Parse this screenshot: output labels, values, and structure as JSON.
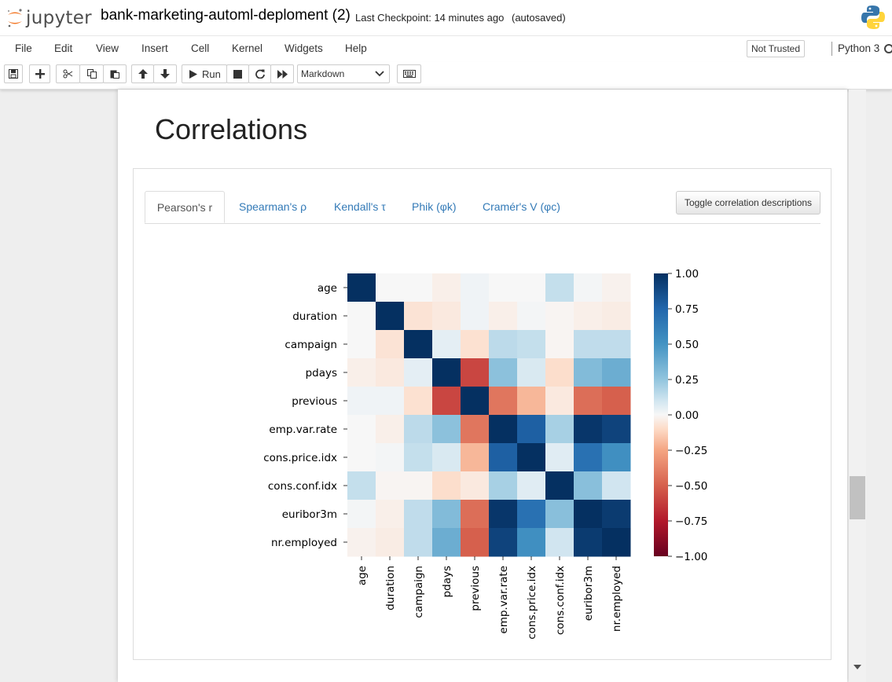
{
  "header": {
    "logo_text": "jupyter",
    "notebook_title": "bank-marketing-automl-deploment (2)",
    "checkpoint": "Last Checkpoint: 14 minutes ago",
    "autosave": "(autosaved)"
  },
  "menu": {
    "items": [
      "File",
      "Edit",
      "View",
      "Insert",
      "Cell",
      "Kernel",
      "Widgets",
      "Help"
    ],
    "trust_label": "Not Trusted",
    "kernel": "Python 3"
  },
  "toolbar": {
    "run_label": "Run",
    "cell_type": "Markdown"
  },
  "cell": {
    "heading": "Correlations"
  },
  "tabs": {
    "items": [
      "Pearson's r",
      "Spearman's ρ",
      "Kendall's τ",
      "Phik (φk)",
      "Cramér's V (φc)"
    ],
    "active_index": 0,
    "toggle_label": "Toggle correlation descriptions"
  },
  "colors": {
    "accent_link": "#337ab7",
    "cmap_low": "#67001f",
    "cmap_mid": "#f7f7f7",
    "cmap_high": "#053061"
  },
  "chart_data": {
    "type": "heatmap",
    "title": "",
    "rows": [
      "age",
      "duration",
      "campaign",
      "pdays",
      "previous",
      "emp.var.rate",
      "cons.price.idx",
      "cons.conf.idx",
      "euribor3m",
      "nr.employed"
    ],
    "columns": [
      "age",
      "duration",
      "campaign",
      "pdays",
      "previous",
      "emp.var.rate",
      "cons.price.idx",
      "cons.conf.idx",
      "euribor3m",
      "nr.employed"
    ],
    "values": [
      [
        1.0,
        0.0,
        0.0,
        -0.03,
        0.02,
        0.0,
        0.0,
        0.13,
        0.01,
        -0.02
      ],
      [
        0.0,
        1.0,
        -0.07,
        -0.05,
        0.02,
        -0.03,
        0.01,
        -0.01,
        -0.03,
        -0.04
      ],
      [
        0.0,
        -0.07,
        1.0,
        0.05,
        -0.08,
        0.15,
        0.13,
        -0.01,
        0.14,
        0.14
      ],
      [
        -0.03,
        -0.05,
        0.05,
        1.0,
        -0.59,
        0.27,
        0.08,
        -0.09,
        0.3,
        0.37
      ],
      [
        0.02,
        0.02,
        -0.08,
        -0.59,
        1.0,
        -0.42,
        -0.2,
        -0.05,
        -0.45,
        -0.5
      ],
      [
        0.0,
        -0.03,
        0.15,
        0.27,
        -0.42,
        1.0,
        0.78,
        0.2,
        0.97,
        0.91
      ],
      [
        0.0,
        0.01,
        0.13,
        0.08,
        -0.2,
        0.78,
        1.0,
        0.06,
        0.69,
        0.52
      ],
      [
        0.13,
        -0.01,
        -0.01,
        -0.09,
        -0.05,
        0.2,
        0.06,
        1.0,
        0.28,
        0.1
      ],
      [
        0.01,
        -0.03,
        0.14,
        0.3,
        -0.45,
        0.97,
        0.69,
        0.28,
        1.0,
        0.95
      ],
      [
        -0.02,
        -0.04,
        0.14,
        0.37,
        -0.5,
        0.91,
        0.52,
        0.1,
        0.95,
        1.0
      ]
    ],
    "colorbar": {
      "range": [
        -1.0,
        1.0
      ],
      "ticks": [
        "1.00",
        "0.75",
        "0.50",
        "0.25",
        "0.00",
        "−0.25",
        "−0.50",
        "−0.75",
        "−1.00"
      ],
      "colormap": "RdBu"
    }
  }
}
